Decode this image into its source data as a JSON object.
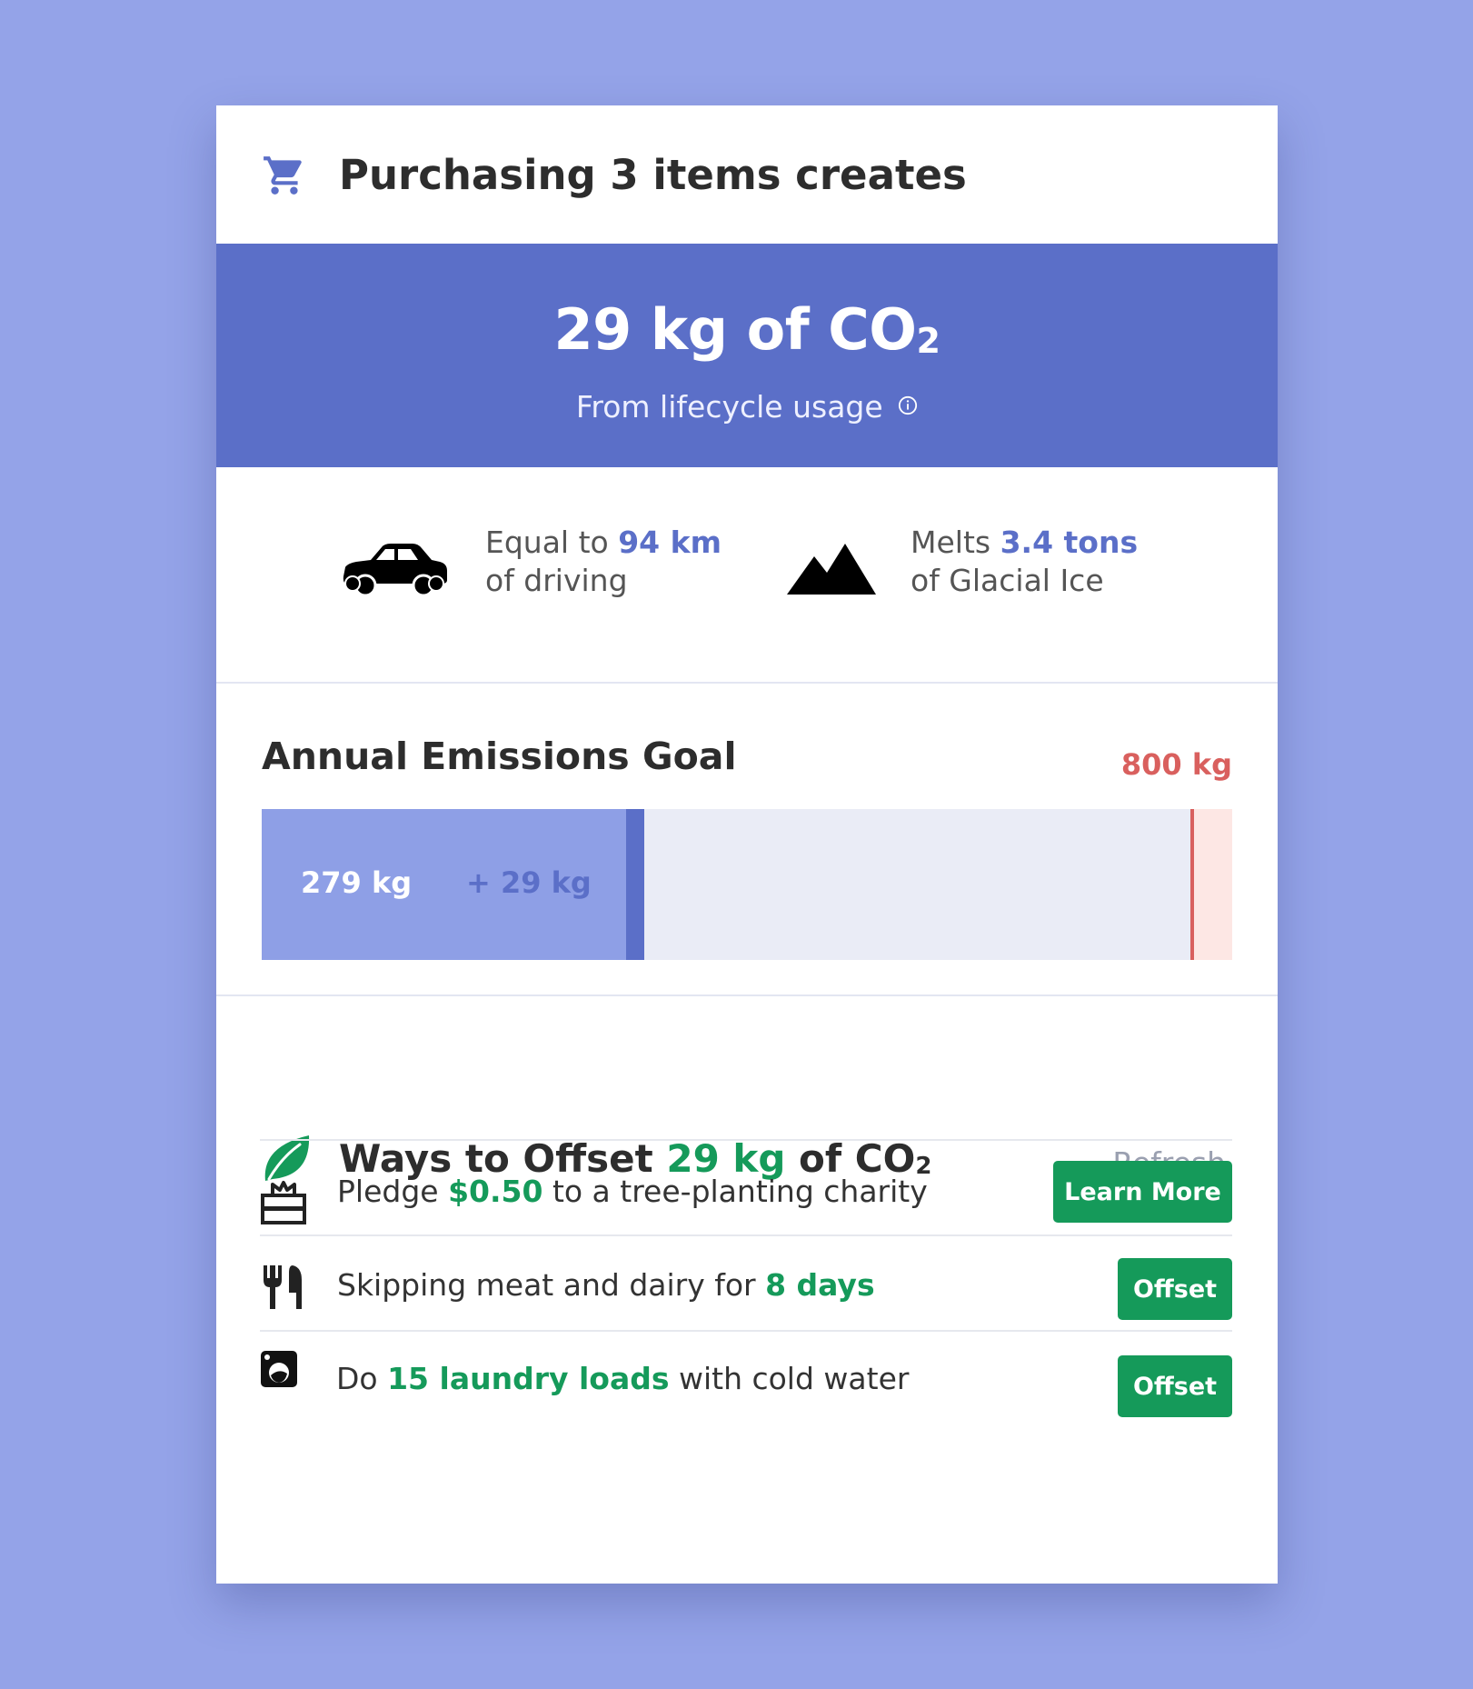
{
  "header": {
    "icon": "shopping-cart-icon",
    "title": "Purchasing 3 items creates"
  },
  "hero": {
    "amount": "29 kg of CO",
    "subscript": "2",
    "subtitle": "From lifecycle usage",
    "info_icon": "info-circle-icon"
  },
  "equivalents": [
    {
      "icon": "car-icon",
      "prefix": "Equal to ",
      "value": "94 km",
      "suffix": "of driving"
    },
    {
      "icon": "mountain-icon",
      "prefix": "Melts ",
      "value": "3.4 tons",
      "suffix": "of Glacial Ice"
    }
  ],
  "goal": {
    "title": "Annual Emissions Goal",
    "limit_label": "800 kg",
    "limit_kg": 800,
    "current_label": "279 kg",
    "current_kg": 279,
    "added_label": "+ 29 kg",
    "added_kg": 29,
    "scale_max_kg": 840
  },
  "offset": {
    "icon": "leaf-icon",
    "title_prefix": "Ways to Offset ",
    "title_value": "29 kg",
    "title_suffix": " of CO",
    "title_subscript": "2",
    "refresh_label": "Refresh",
    "items": [
      {
        "icon": "gift-icon",
        "pre": "Pledge ",
        "value": "$0.50",
        "post": " to a tree-planting charity",
        "button": "Learn More"
      },
      {
        "icon": "utensils-icon",
        "pre": "Skipping meat and dairy for ",
        "value": "8 days",
        "post": "",
        "button": "Offset"
      },
      {
        "icon": "washing-machine-icon",
        "pre": "Do ",
        "value": "15 laundry loads",
        "post": " with cold water",
        "button": "Offset"
      }
    ]
  },
  "colors": {
    "background": "#94a3e8",
    "primary": "#5b6fc8",
    "accent_green": "#159a5a",
    "limit_red": "#d9605e"
  }
}
